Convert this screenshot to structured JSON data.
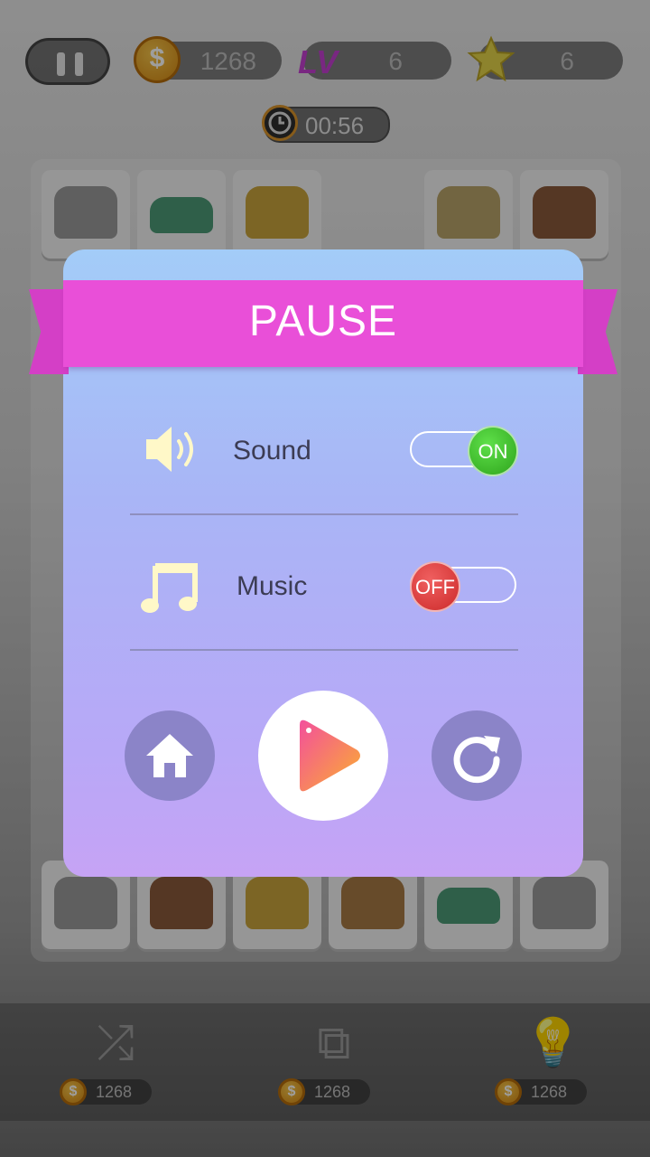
{
  "hud": {
    "coins": "1268",
    "level_label": "LV",
    "level": "6",
    "stars": "6",
    "timer": "00:56"
  },
  "tools": [
    {
      "name": "shuffle",
      "cost": "1268"
    },
    {
      "name": "rearrange",
      "cost": "1268"
    },
    {
      "name": "hint",
      "cost": "1268"
    }
  ],
  "pause_dialog": {
    "title": "PAUSE",
    "sound": {
      "label": "Sound",
      "state": "ON"
    },
    "music": {
      "label": "Music",
      "state": "OFF"
    },
    "buttons": [
      "home",
      "play",
      "restart"
    ]
  },
  "colors": {
    "ribbon": "#e94fd8",
    "toggle_on": "#3bc52a",
    "toggle_off": "#e03a3a",
    "icon_cream": "#fff8c8"
  }
}
